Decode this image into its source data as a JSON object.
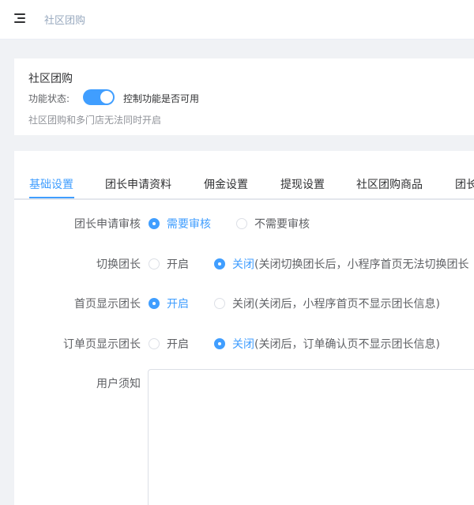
{
  "header": {
    "breadcrumb": "社区团购"
  },
  "feature_card": {
    "title": "社区团购",
    "status_label": "功能状态:",
    "switch_enabled": true,
    "switch_text": "控制功能是否可用",
    "hint": "社区团购和多门店无法同时开启"
  },
  "tabs": [
    {
      "label": "基础设置",
      "active": true
    },
    {
      "label": "团长申请资料",
      "active": false
    },
    {
      "label": "佣金设置",
      "active": false
    },
    {
      "label": "提现设置",
      "active": false
    },
    {
      "label": "社区团购商品",
      "active": false
    },
    {
      "label": "团长",
      "active": false
    }
  ],
  "form": {
    "review": {
      "label": "团长申请审核",
      "options": [
        {
          "text": "需要审核",
          "checked": true
        },
        {
          "text": "不需要审核",
          "checked": false
        }
      ]
    },
    "switch_leader": {
      "label": "切换团长",
      "options": [
        {
          "text": "开启",
          "checked": false
        },
        {
          "text": "关闭",
          "checked": true
        }
      ],
      "note": "(关闭切换团长后，小程序首页无法切换团长"
    },
    "home_show": {
      "label": "首页显示团长",
      "options": [
        {
          "text": "开启",
          "checked": true
        },
        {
          "text": "关闭",
          "checked": false
        }
      ],
      "note": "(关闭后，小程序首页不显示团长信息)"
    },
    "order_show": {
      "label": "订单页显示团长",
      "options": [
        {
          "text": "开启",
          "checked": false
        },
        {
          "text": "关闭",
          "checked": true
        }
      ],
      "note": "(关闭后，订单确认页不显示团长信息)"
    },
    "notice": {
      "label": "用户须知",
      "value": ""
    }
  },
  "colors": {
    "accent": "#409eff",
    "text": "#303133",
    "muted": "#909399",
    "background": "#f0f2f5"
  }
}
